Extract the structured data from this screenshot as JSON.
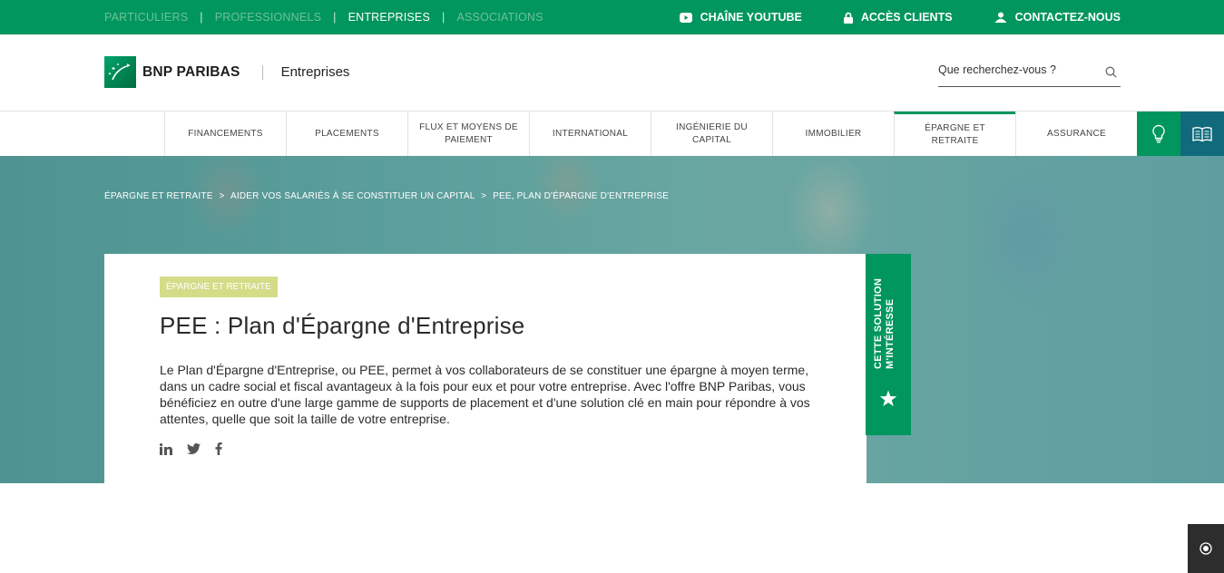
{
  "topbar": {
    "audiences": [
      {
        "label": "PARTICULIERS",
        "active": false
      },
      {
        "label": "PROFESSIONNELS",
        "active": false
      },
      {
        "label": "ENTREPRISES",
        "active": true
      },
      {
        "label": "ASSOCIATIONS",
        "active": false
      }
    ],
    "separator": "|",
    "links": {
      "youtube": "CHAÎNE YOUTUBE",
      "clients": "ACCÈS CLIENTS",
      "contact": "CONTACTEZ-NOUS"
    }
  },
  "header": {
    "brand": "BNP PARIBAS",
    "section": "Entreprises",
    "search_placeholder": "Que recherchez-vous ?"
  },
  "nav": {
    "items": [
      {
        "label": "FINANCEMENTS",
        "active": false
      },
      {
        "label": "PLACEMENTS",
        "active": false
      },
      {
        "label": "FLUX ET MOYENS DE PAIEMENT",
        "active": false
      },
      {
        "label": "INTERNATIONAL",
        "active": false
      },
      {
        "label": "INGÉNIERIE DU CAPITAL",
        "active": false
      },
      {
        "label": "IMMOBILIER",
        "active": false
      },
      {
        "label": "ÉPARGNE ET RETRAITE",
        "active": true
      },
      {
        "label": "ASSURANCE",
        "active": false
      }
    ],
    "icons": [
      "lightbulb-icon",
      "book-icon"
    ]
  },
  "breadcrumb": {
    "items": [
      "ÉPARGNE ET RETRAITE",
      "AIDER VOS SALARIÉS À SE CONSTITUER UN CAPITAL",
      "PEE, PLAN D'ÉPARGNE D'ENTREPRISE"
    ],
    "separator": ">"
  },
  "card": {
    "tag": "ÉPARGNE ET RETRAITE",
    "title": "PEE : Plan d'Épargne d'Entreprise",
    "description": "Le Plan d'Épargne d'Entreprise, ou PEE, permet à vos collaborateurs de se constituer une épargne à moyen terme, dans un cadre social et fiscal avantageux à la fois pour eux et pour votre entreprise. Avec l'offre BNP Paribas, vous bénéficiez en outre d'une large gamme de supports de placement et d'une solution clé en main pour répondre à vos attentes, quelle que soit la taille de votre entreprise.",
    "social": [
      "linkedin-icon",
      "twitter-icon",
      "facebook-icon"
    ]
  },
  "interest": {
    "label": "CETTE SOLUTION M'INTÉRESSE",
    "icon": "star-icon"
  },
  "colors": {
    "brand_green": "#00965e",
    "teal": "#116a7b",
    "tag_bg": "#d4dc88"
  }
}
